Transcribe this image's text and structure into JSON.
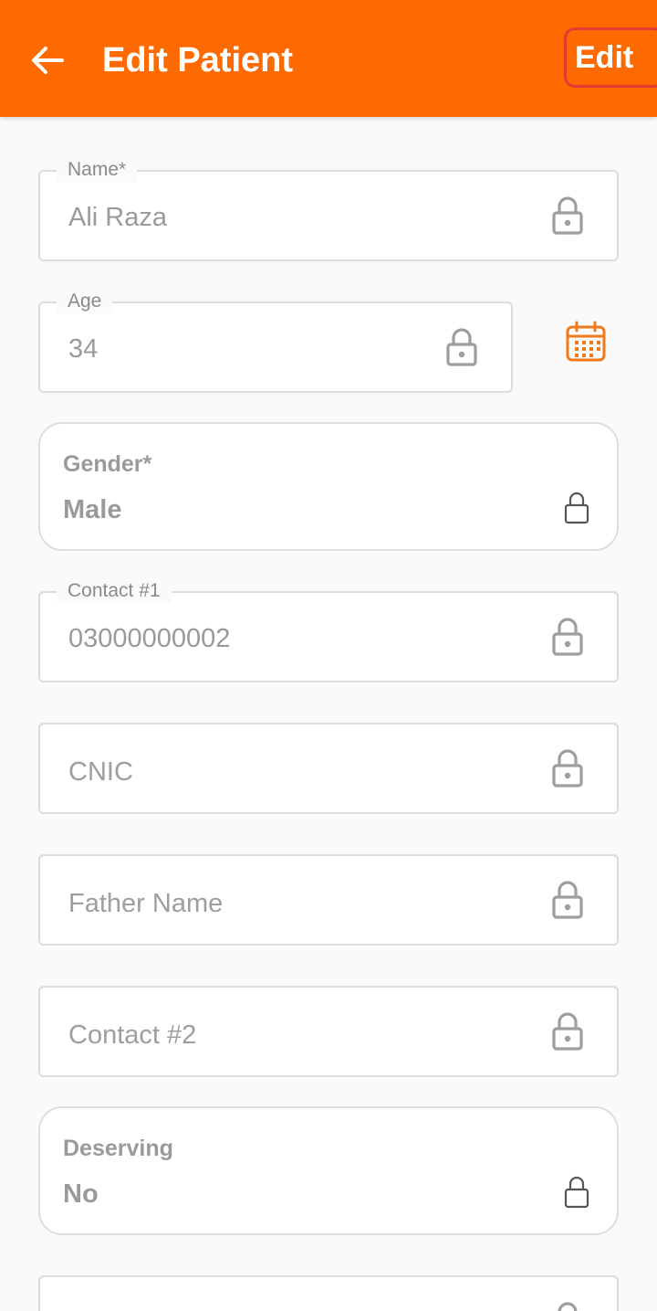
{
  "appbar": {
    "title": "Edit Patient",
    "edit_label": "Edit",
    "back_icon": "arrow-left-icon",
    "background": "#ff6a00"
  },
  "fields": {
    "name": {
      "label": "Name*",
      "value": "Ali Raza"
    },
    "age": {
      "label": "Age",
      "value": "34"
    },
    "contact1": {
      "label": "Contact #1",
      "value": "03000000002"
    },
    "cnic": {
      "placeholder": "CNIC"
    },
    "father_name": {
      "placeholder": "Father Name"
    },
    "contact2": {
      "placeholder": "Contact #2"
    }
  },
  "selectors": {
    "gender": {
      "label": "Gender*",
      "value": "Male"
    },
    "deserving": {
      "label": "Deserving",
      "value": "No"
    }
  },
  "icons": {
    "lock": "lock-icon",
    "calendar": "calendar-icon"
  },
  "colors": {
    "accent": "#ff6a00",
    "edit_border": "#e53935",
    "calendar": "#f07a1a"
  }
}
